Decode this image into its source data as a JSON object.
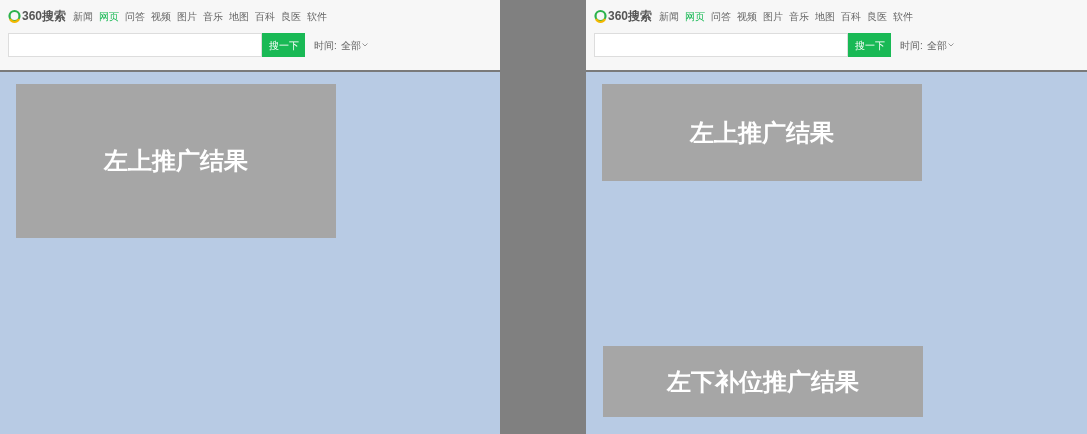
{
  "panels": [
    {
      "kind": "large",
      "logo": "360搜索",
      "nav": [
        {
          "label": "新闻",
          "selected": false
        },
        {
          "label": "网页",
          "selected": true
        },
        {
          "label": "问答",
          "selected": false
        },
        {
          "label": "视频",
          "selected": false
        },
        {
          "label": "图片",
          "selected": false
        },
        {
          "label": "音乐",
          "selected": false
        },
        {
          "label": "地图",
          "selected": false
        },
        {
          "label": "百科",
          "selected": false
        },
        {
          "label": "良医",
          "selected": false
        },
        {
          "label": "软件",
          "selected": false
        }
      ],
      "search_button": "搜一下",
      "time_filter": {
        "label": "时间:",
        "value": "全部"
      },
      "ads": [
        "左上推广结果"
      ]
    },
    {
      "kind": "split",
      "logo": "360搜索",
      "nav": [
        {
          "label": "新闻",
          "selected": false
        },
        {
          "label": "网页",
          "selected": true
        },
        {
          "label": "问答",
          "selected": false
        },
        {
          "label": "视频",
          "selected": false
        },
        {
          "label": "图片",
          "selected": false
        },
        {
          "label": "音乐",
          "selected": false
        },
        {
          "label": "地图",
          "selected": false
        },
        {
          "label": "百科",
          "selected": false
        },
        {
          "label": "良医",
          "selected": false
        },
        {
          "label": "软件",
          "selected": false
        }
      ],
      "search_button": "搜一下",
      "time_filter": {
        "label": "时间:",
        "value": "全部"
      },
      "ads": [
        "左上推广结果",
        "左下补位推广结果"
      ]
    }
  ]
}
